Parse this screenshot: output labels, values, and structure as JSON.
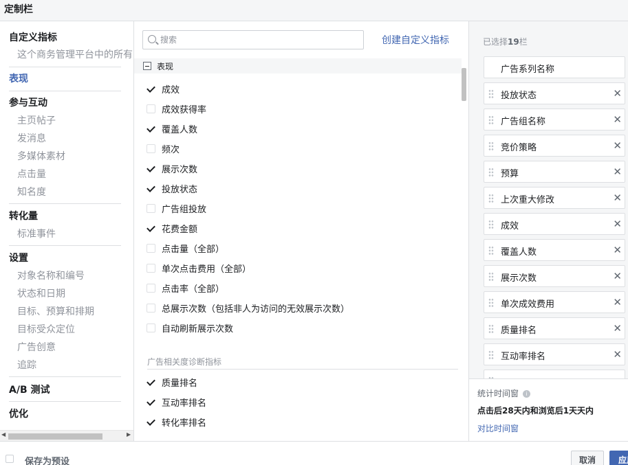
{
  "title": "定制栏",
  "nav": {
    "custom_metrics": "自定义指标",
    "custom_metrics_sub": "这个商务管理平台中的所有",
    "performance": "表现",
    "engagement": "参与互动",
    "engagement_items": [
      "主页帖子",
      "发消息",
      "多媒体素材",
      "点击量",
      "知名度"
    ],
    "conversions": "转化量",
    "conversions_items": [
      "标准事件"
    ],
    "settings": "设置",
    "settings_items": [
      "对象名称和编号",
      "状态和日期",
      "目标、预算和排期",
      "目标受众定位",
      "广告创意",
      "追踪"
    ],
    "ab_test": "A/B 测试",
    "optimization": "优化"
  },
  "search": {
    "placeholder": "搜索"
  },
  "create_link": "创建自定义指标",
  "performance_section": {
    "header": "表现",
    "items": [
      {
        "label": "成效",
        "checked": true
      },
      {
        "label": "成效获得率",
        "checked": false
      },
      {
        "label": "覆盖人数",
        "checked": true
      },
      {
        "label": "频次",
        "checked": false
      },
      {
        "label": "展示次数",
        "checked": true
      },
      {
        "label": "投放状态",
        "checked": true
      },
      {
        "label": "广告组投放",
        "checked": false
      },
      {
        "label": "花费金额",
        "checked": true
      },
      {
        "label": "点击量（全部）",
        "checked": false
      },
      {
        "label": "单次点击费用（全部）",
        "checked": false
      },
      {
        "label": "点击率（全部）",
        "checked": false
      },
      {
        "label": "总展示次数（包括非人为访问的无效展示次数）",
        "checked": false
      },
      {
        "label": "自动刷新展示次数",
        "checked": false
      }
    ]
  },
  "diagnostics_section": {
    "title": "广告相关度诊断指标",
    "items": [
      {
        "label": "质量排名",
        "checked": true
      },
      {
        "label": "互动率排名",
        "checked": true
      },
      {
        "label": "转化率排名",
        "checked": true
      }
    ]
  },
  "selected": {
    "prefix": "已选择",
    "count": "19",
    "suffix": "栏",
    "items": [
      {
        "label": "广告系列名称",
        "removable": false
      },
      {
        "label": "投放状态",
        "removable": true
      },
      {
        "label": "广告组名称",
        "removable": true
      },
      {
        "label": "竞价策略",
        "removable": true
      },
      {
        "label": "预算",
        "removable": true
      },
      {
        "label": "上次重大修改",
        "removable": true
      },
      {
        "label": "成效",
        "removable": true
      },
      {
        "label": "覆盖人数",
        "removable": true
      },
      {
        "label": "展示次数",
        "removable": true
      },
      {
        "label": "单次成效费用",
        "removable": true
      },
      {
        "label": "质量排名",
        "removable": true
      },
      {
        "label": "互动率排名",
        "removable": true
      }
    ],
    "remove_glyph": "✕"
  },
  "attribution": {
    "title": "统计时间窗",
    "value": "点击后28天内和浏览后1天天内",
    "link": "对比时间窗"
  },
  "footer": {
    "save_preset": "保存为预设",
    "cancel": "取消",
    "apply": "应用"
  }
}
